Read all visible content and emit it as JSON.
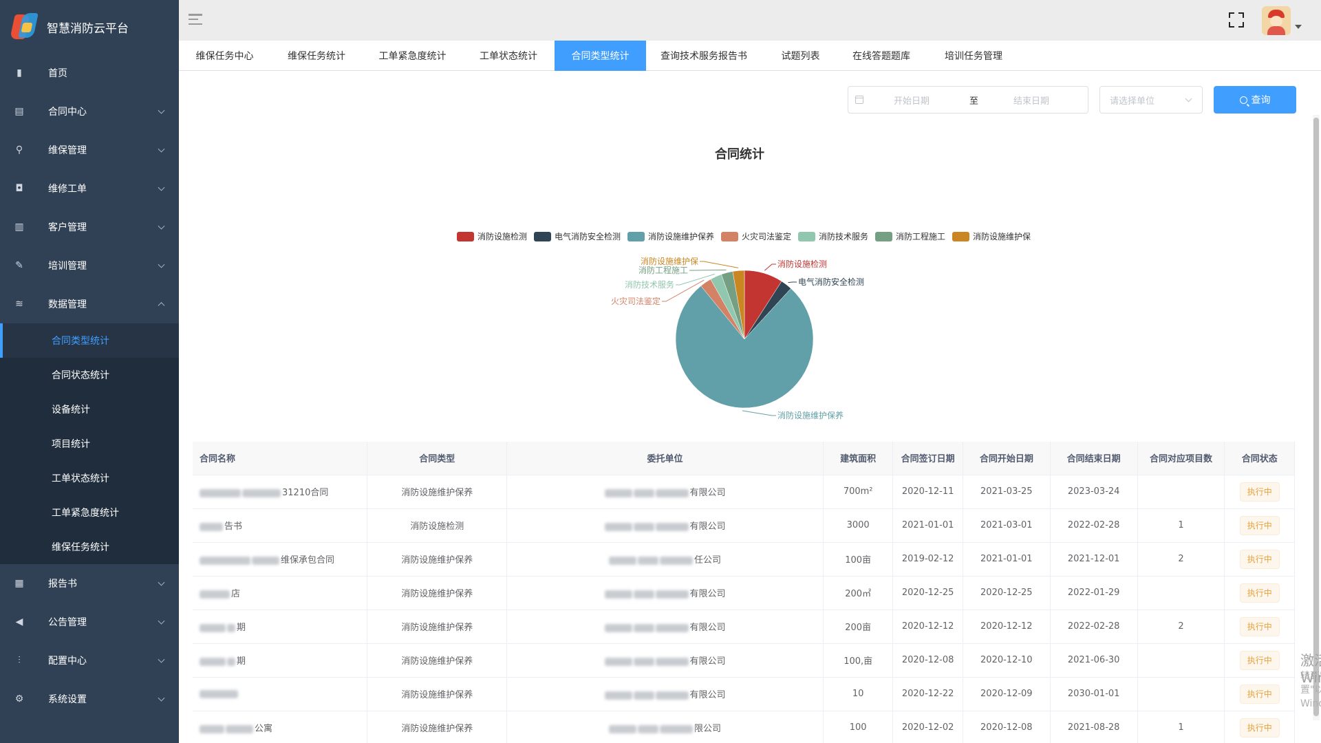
{
  "app": {
    "title": "智慧消防云平台"
  },
  "sidebar": {
    "items": [
      {
        "label": "首页",
        "icon": "bar-chart-icon"
      },
      {
        "label": "合同中心",
        "icon": "document-icon"
      },
      {
        "label": "维保管理",
        "icon": "location-pin-icon"
      },
      {
        "label": "维修工单",
        "icon": "lock-icon"
      },
      {
        "label": "客户管理",
        "icon": "building-icon"
      },
      {
        "label": "培训管理",
        "icon": "tools-icon"
      },
      {
        "label": "数据管理",
        "icon": "layers-icon"
      }
    ],
    "sub_items": [
      {
        "label": "合同类型统计"
      },
      {
        "label": "合同状态统计"
      },
      {
        "label": "设备统计"
      },
      {
        "label": "项目统计"
      },
      {
        "label": "工单状态统计"
      },
      {
        "label": "工单紧急度统计"
      },
      {
        "label": "维保任务统计"
      }
    ],
    "items_after": [
      {
        "label": "报告书",
        "icon": "report-icon"
      },
      {
        "label": "公告管理",
        "icon": "speaker-icon"
      },
      {
        "label": "配置中心",
        "icon": "sliders-icon"
      },
      {
        "label": "系统设置",
        "icon": "gear-icon"
      }
    ]
  },
  "tabs": [
    {
      "label": "维保任务中心"
    },
    {
      "label": "维保任务统计"
    },
    {
      "label": "工单紧急度统计"
    },
    {
      "label": "工单状态统计"
    },
    {
      "label": "合同类型统计"
    },
    {
      "label": "查询技术服务报告书"
    },
    {
      "label": "试题列表"
    },
    {
      "label": "在线答题题库"
    },
    {
      "label": "培训任务管理"
    }
  ],
  "filter": {
    "start_placeholder": "开始日期",
    "separator": "至",
    "end_placeholder": "结束日期",
    "unit_placeholder": "请选择单位",
    "query_label": "查询"
  },
  "chart_data": {
    "type": "pie",
    "title": "合同统计",
    "legend_position": "top-center",
    "series": [
      {
        "name": "消防设施检测",
        "value": 1,
        "color": "#c23531"
      },
      {
        "name": "电气消防安全检测",
        "value": 0.3,
        "color": "#2f4554"
      },
      {
        "name": "消防设施维护保养",
        "value": 8.5,
        "color": "#61a0a8"
      },
      {
        "name": "火灾司法鉴定",
        "value": 0.3,
        "color": "#d48265"
      },
      {
        "name": "消防技术服务",
        "value": 0.3,
        "color": "#91c7ae"
      },
      {
        "name": "消防工程施工",
        "value": 0.3,
        "color": "#749f83"
      },
      {
        "name": "消防设施维护保",
        "value": 0.3,
        "color": "#ca8622"
      }
    ]
  },
  "table": {
    "headers": [
      "合同名称",
      "合同类型",
      "委托单位",
      "建筑面积",
      "合同签订日期",
      "合同开始日期",
      "合同结束日期",
      "合同对应项目数",
      "合同状态"
    ],
    "rows": [
      {
        "name": "31210合同",
        "type": "消防设施维护保养",
        "client": "有限公司",
        "area": "700m²",
        "signed": "2020-12-11",
        "start": "2021-03-25",
        "end": "2023-03-24",
        "projects": "",
        "status": "执行中"
      },
      {
        "name": "告书",
        "type": "消防设施检测",
        "client": "有限公司",
        "area": "3000",
        "signed": "2021-01-01",
        "start": "2021-03-01",
        "end": "2022-02-28",
        "projects": "1",
        "status": "执行中"
      },
      {
        "name": "维保承包合同",
        "type": "消防设施维护保养",
        "client": "任公司",
        "area": "100亩",
        "signed": "2019-02-12",
        "start": "2021-01-01",
        "end": "2021-12-01",
        "projects": "2",
        "status": "执行中"
      },
      {
        "name": "店",
        "type": "消防设施维护保养",
        "client": "有限公司",
        "area": "200㎡",
        "signed": "2020-12-25",
        "start": "2020-12-25",
        "end": "2022-01-29",
        "projects": "",
        "status": "执行中"
      },
      {
        "name": "期",
        "type": "消防设施维护保养",
        "client": "有限公司",
        "area": "200亩",
        "signed": "2020-12-12",
        "start": "2020-12-12",
        "end": "2022-02-28",
        "projects": "2",
        "status": "执行中"
      },
      {
        "name": "期",
        "type": "消防设施维护保养",
        "client": "有限公司",
        "area": "100,亩",
        "signed": "2020-12-08",
        "start": "2020-12-10",
        "end": "2021-06-30",
        "projects": "",
        "status": "执行中"
      },
      {
        "name": "",
        "type": "消防设施维护保养",
        "client": "有限公司",
        "area": "10",
        "signed": "2020-12-22",
        "start": "2020-12-09",
        "end": "2030-01-01",
        "projects": "",
        "status": "执行中"
      },
      {
        "name": "公寓",
        "type": "消防设施维护保养",
        "client": "限公司",
        "area": "100",
        "signed": "2020-12-02",
        "start": "2020-12-08",
        "end": "2021-08-28",
        "projects": "1",
        "status": "执行中"
      }
    ]
  },
  "watermark": {
    "line1": "激活 Windows",
    "line2": "转到\"设置\"以激活 Windows。"
  }
}
